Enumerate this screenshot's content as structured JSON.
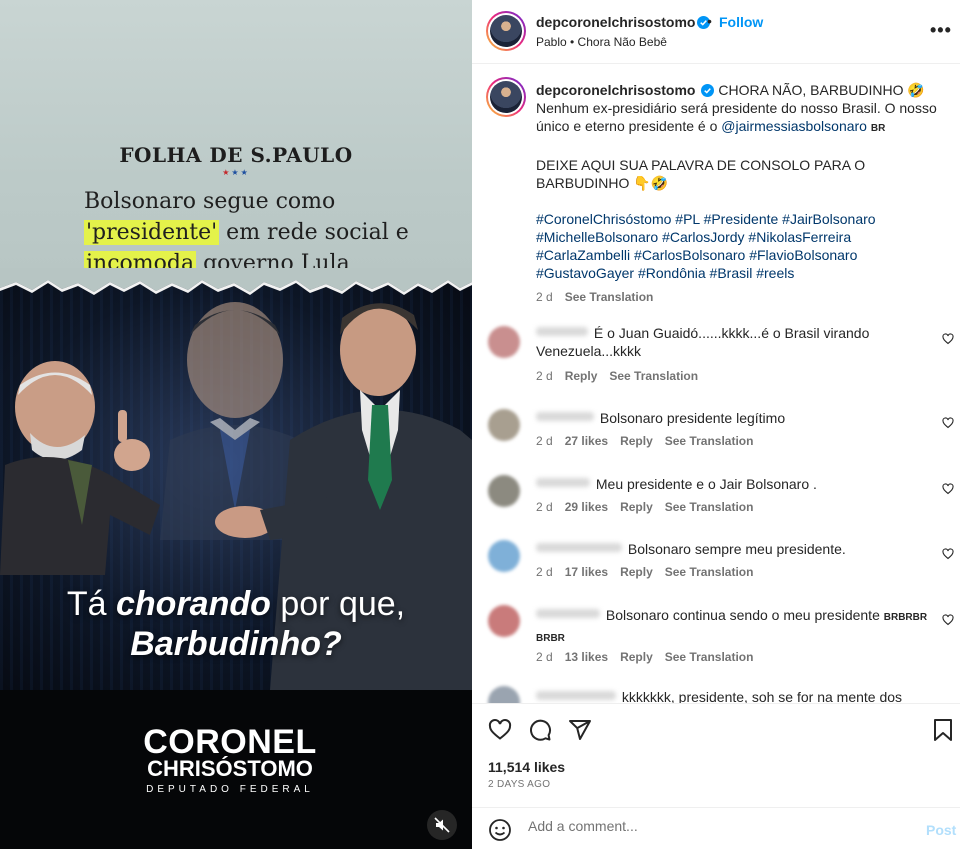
{
  "media": {
    "newspaper": "FOLHA DE S.PAULO",
    "headline_pre": "Bolsonaro segue como ",
    "headline_hl1": "'presidente'",
    "headline_mid": " em rede social e ",
    "headline_hl2": "incomoda",
    "headline_post": " governo Lula",
    "overlay_line1_pre": "Tá ",
    "overlay_line1_bold": "chorando",
    "overlay_line1_post": " por que,",
    "overlay_line2": "Barbudinho?",
    "brand_line1": "CORONEL",
    "brand_line2": "CHRISÓSTOMO",
    "brand_line3": "DEPUTADO FEDERAL"
  },
  "header": {
    "username": "depcoronelchrisostomo",
    "separator": "•",
    "follow_label": "Follow",
    "audio": "Pablo • Chora Não Bebê",
    "more": "•••"
  },
  "caption": {
    "username": "depcoronelchrisostomo",
    "line1": "CHORA NÃO, BARBUDINHO 🤣",
    "line2": "Nenhum ex-presidiário será presidente do nosso Brasil. O nosso único e eterno presidente é o",
    "mention": "@jairmessiasbolsonaro",
    "flag": "BR",
    "line3": "DEIXE AQUI SUA PALAVRA DE CONSOLO PARA O BARBUDINHO 👇🤣",
    "hashtags": "#CoronelChrisóstomo #PL #Presidente #JairBolsonaro #MichelleBolsonaro #CarlosJordy #NikolasFerreira #CarlaZambelli #CarlosBolsonaro #FlavioBolsonaro #GustavoGayer #Rondônia #Brasil #reels",
    "time": "2 d",
    "see_translation": "See Translation"
  },
  "comments": [
    {
      "text": "É o Juan Guaidó......kkkk...é o Brasil virando Venezuela...kkkk",
      "time": "2 d",
      "likes": "",
      "reply": "Reply",
      "translate": "See Translation",
      "color": "#c98f8f"
    },
    {
      "text": "Bolsonaro presidente legítimo",
      "time": "2 d",
      "likes": "27 likes",
      "reply": "Reply",
      "translate": "See Translation",
      "color": "#a89f90"
    },
    {
      "text": "Meu presidente e o Jair Bolsonaro .",
      "time": "2 d",
      "likes": "29 likes",
      "reply": "Reply",
      "translate": "See Translation",
      "color": "#8c8a80"
    },
    {
      "text": "Bolsonaro sempre meu presidente.",
      "time": "2 d",
      "likes": "17 likes",
      "reply": "Reply",
      "translate": "See Translation",
      "color": "#7fb0d8"
    },
    {
      "text": "Bolsonaro continua sendo o meu presidente",
      "flags": "BRBRBR",
      "flags2": "BRBR",
      "time": "2 d",
      "likes": "13 likes",
      "reply": "Reply",
      "translate": "See Translation",
      "color": "#c97b7b"
    },
    {
      "text": "kkkkkkk, presidente, soh se for na mente dos",
      "color": "#9aa4b0"
    }
  ],
  "footer": {
    "likes": "11,514 likes",
    "ago": "2 DAYS AGO",
    "comment_placeholder": "Add a comment...",
    "post_label": "Post"
  },
  "colors": {
    "accent": "#0095f6",
    "link": "#00376b",
    "muted": "#737373",
    "highlight": "#e4f24a"
  }
}
